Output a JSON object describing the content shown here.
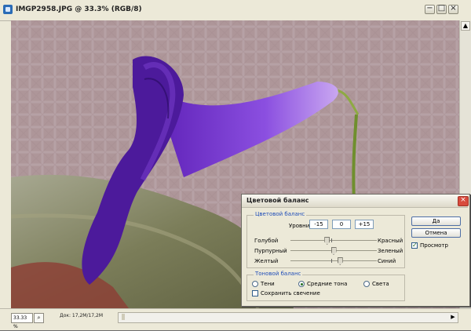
{
  "window": {
    "title": "IMGP2958.JPG @ 33.3% (RGB/8)",
    "minimize_icon": "−",
    "maximize_icon": "□",
    "close_icon": "×"
  },
  "status_bar": {
    "zoom": "33.33 %",
    "nav_icon": "⌕",
    "doc_size": "Док: 17,2M/17,2M",
    "right_arrow": "▶"
  },
  "dialog": {
    "title": "Цветовой баланс",
    "close_icon": "×",
    "color_balance": {
      "label": "Цветовой баланс",
      "levels_label": "Уровни:",
      "levels": [
        "-15",
        "0",
        "+15"
      ],
      "sliders": [
        {
          "left": "Голубой",
          "right": "Красный",
          "value": -15
        },
        {
          "left": "Пурпурный",
          "right": "Зеленый",
          "value": 0
        },
        {
          "left": "Желтый",
          "right": "Синий",
          "value": 15
        }
      ]
    },
    "tone_balance": {
      "label": "Тоновой баланс",
      "options": [
        {
          "label": "Тени",
          "selected": false
        },
        {
          "label": "Средние тона",
          "selected": true
        },
        {
          "label": "Света",
          "selected": false
        }
      ],
      "preserve_luminosity": "Сохранить свечение",
      "preserve_luminosity_checked": false
    },
    "buttons": {
      "ok": "Да",
      "cancel": "Отмена"
    },
    "preview_label": "Просмотр",
    "preview_checked": true
  },
  "scrollbar": {
    "up": "▲",
    "down": "▼"
  }
}
